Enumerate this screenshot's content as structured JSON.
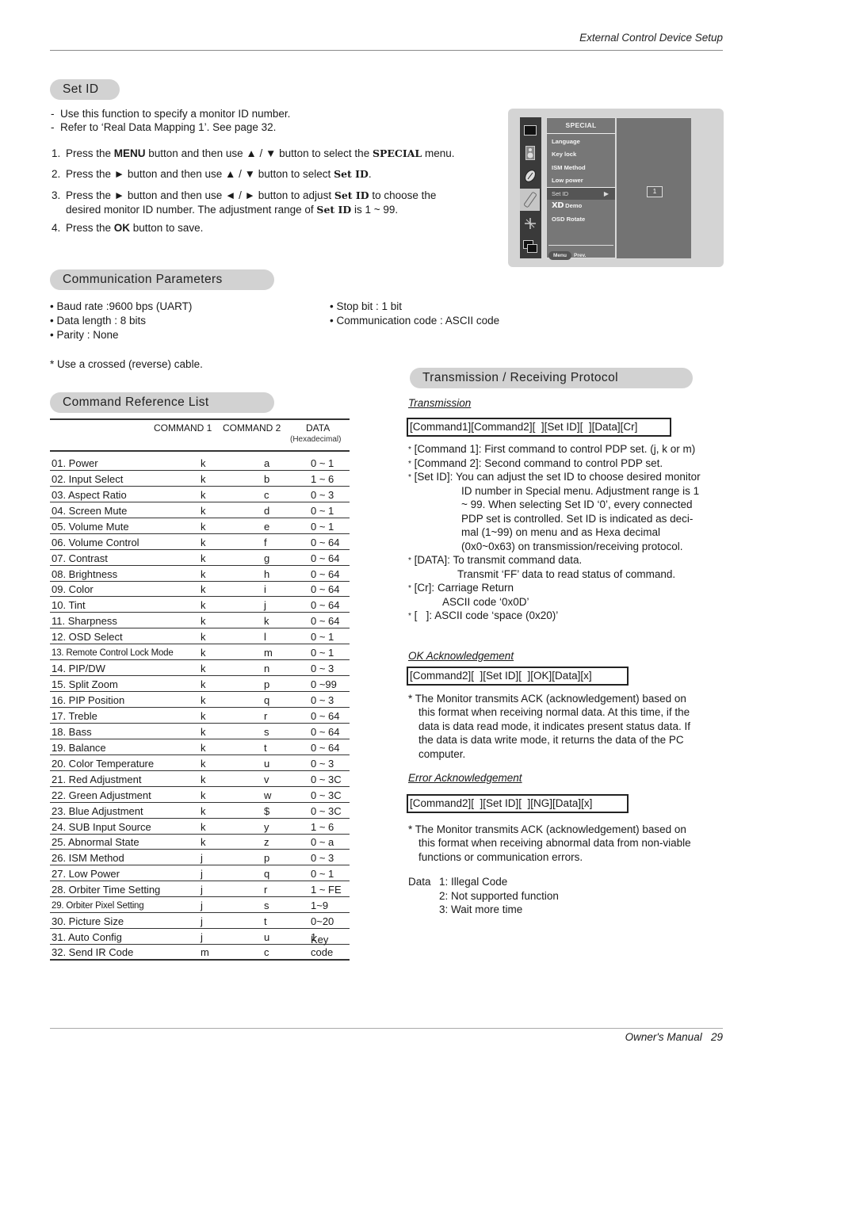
{
  "header": {
    "running_title": "External Control Device Setup"
  },
  "footer": {
    "label": "Owner's Manual",
    "page_number": "29"
  },
  "set_id": {
    "heading": "Set ID",
    "notes": [
      "Use this function to specify a monitor ID number.",
      "Refer to ‘Real Data Mapping 1’. See page 32."
    ],
    "steps": [
      {
        "num": "1.",
        "parts": [
          "Press the ",
          "MENU",
          " button and then use ",
          "▲ / ▼",
          " button to select the ",
          "SPECIAL",
          " menu."
        ]
      },
      {
        "num": "2.",
        "parts": [
          "Press the ",
          "►",
          " button and then use ",
          "▲ / ▼",
          " button to select ",
          "Set ID",
          "."
        ]
      },
      {
        "num": "3.",
        "line1": [
          "Press the ",
          "►",
          " button and then use ",
          "◄ / ►",
          " button to adjust  ",
          "Set ID",
          " to choose the"
        ],
        "line2": [
          "desired monitor ID number. The adjustment range of ",
          "Set ID",
          " is 1 ~ 99."
        ]
      },
      {
        "num": "4.",
        "parts": [
          "Press the ",
          "OK",
          " button to save."
        ]
      }
    ]
  },
  "osd": {
    "menu_title": "SPECIAL",
    "items": [
      "Language",
      "Key lock",
      "ISM Method",
      "Low power",
      "Set ID",
      "Demo",
      "OSD Rotate"
    ],
    "selected_item": "Set ID",
    "xd_logo": "XD",
    "footer_button": "Menu",
    "footer_label": "Prev.",
    "value": "1",
    "side_icons": [
      "picture-icon",
      "speaker-icon",
      "time-icon",
      "special-icon",
      "screen-icon",
      "pip-icon"
    ]
  },
  "comm_params": {
    "heading": "Communication Parameters",
    "left": [
      "Baud rate :9600 bps (UART)",
      "Data length : 8 bits",
      "Parity : None"
    ],
    "right": [
      "Stop bit : 1 bit",
      "Communication code : ASCII code"
    ],
    "note": "* Use a crossed (reverse) cable."
  },
  "command_list": {
    "heading": "Command Reference List",
    "columns": [
      "COMMAND 1",
      "COMMAND 2",
      "DATA"
    ],
    "data_subheader": "(Hexadecimal)",
    "rows": [
      {
        "name": "01. Power",
        "cmd1": "k",
        "cmd2": "a",
        "data": "0 ~ 1"
      },
      {
        "name": "02. Input Select",
        "cmd1": "k",
        "cmd2": "b",
        "data": "1 ~ 6"
      },
      {
        "name": "03. Aspect Ratio",
        "cmd1": "k",
        "cmd2": "c",
        "data": "0 ~ 3"
      },
      {
        "name": "04. Screen Mute",
        "cmd1": "k",
        "cmd2": "d",
        "data": "0 ~ 1"
      },
      {
        "name": "05. Volume Mute",
        "cmd1": "k",
        "cmd2": "e",
        "data": "0 ~ 1"
      },
      {
        "name": "06. Volume Control",
        "cmd1": "k",
        "cmd2": "f",
        "data": "0 ~ 64"
      },
      {
        "name": "07. Contrast",
        "cmd1": "k",
        "cmd2": "g",
        "data": "0 ~ 64"
      },
      {
        "name": "08. Brightness",
        "cmd1": "k",
        "cmd2": "h",
        "data": "0 ~ 64"
      },
      {
        "name": "09. Color",
        "cmd1": "k",
        "cmd2": "i",
        "data": "0 ~ 64"
      },
      {
        "name": "10. Tint",
        "cmd1": "k",
        "cmd2": "j",
        "data": "0 ~ 64"
      },
      {
        "name": "11. Sharpness",
        "cmd1": "k",
        "cmd2": "k",
        "data": "0 ~ 64"
      },
      {
        "name": "12. OSD Select",
        "cmd1": "k",
        "cmd2": "l",
        "data": "0 ~ 1"
      },
      {
        "name": "13. Remote Control Lock Mode",
        "cmd1": "k",
        "cmd2": "m",
        "data": "0 ~ 1"
      },
      {
        "name": "14. PIP/DW",
        "cmd1": "k",
        "cmd2": "n",
        "data": "0 ~ 3"
      },
      {
        "name": "15. Split Zoom",
        "cmd1": "k",
        "cmd2": "p",
        "data": "0 ~99"
      },
      {
        "name": "16. PIP Position",
        "cmd1": "k",
        "cmd2": "q",
        "data": "0 ~ 3"
      },
      {
        "name": "17. Treble",
        "cmd1": "k",
        "cmd2": "r",
        "data": "0 ~ 64"
      },
      {
        "name": "18. Bass",
        "cmd1": "k",
        "cmd2": "s",
        "data": "0 ~ 64"
      },
      {
        "name": "19. Balance",
        "cmd1": "k",
        "cmd2": "t",
        "data": "0 ~ 64"
      },
      {
        "name": "20. Color Temperature",
        "cmd1": "k",
        "cmd2": "u",
        "data": "0 ~ 3"
      },
      {
        "name": "21. Red Adjustment",
        "cmd1": "k",
        "cmd2": "v",
        "data": "0 ~ 3C"
      },
      {
        "name": "22. Green Adjustment",
        "cmd1": "k",
        "cmd2": "w",
        "data": "0 ~ 3C"
      },
      {
        "name": "23. Blue Adjustment",
        "cmd1": "k",
        "cmd2": "$",
        "data": "0 ~ 3C"
      },
      {
        "name": "24. SUB Input Source",
        "cmd1": "k",
        "cmd2": "y",
        "data": "1 ~ 6"
      },
      {
        "name": "25. Abnormal State",
        "cmd1": "k",
        "cmd2": "z",
        "data": "0 ~ a"
      },
      {
        "name": "26. ISM Method",
        "cmd1": "j",
        "cmd2": "p",
        "data": "0 ~ 3"
      },
      {
        "name": "27. Low Power",
        "cmd1": "j",
        "cmd2": "q",
        "data": "0 ~ 1"
      },
      {
        "name": "28. Orbiter Time Setting",
        "cmd1": "j",
        "cmd2": "r",
        "data": "1 ~ FE"
      },
      {
        "name": "29. Orbiter Pixel Setting",
        "cmd1": "j",
        "cmd2": "s",
        "data": "1~9"
      },
      {
        "name": "30. Picture Size",
        "cmd1": "j",
        "cmd2": "t",
        "data": "0~20"
      },
      {
        "name": "31. Auto Config",
        "cmd1": "j",
        "cmd2": "u",
        "data": "1"
      },
      {
        "name": "32. Send IR Code",
        "cmd1": "m",
        "cmd2": "c",
        "data": "Key code"
      }
    ]
  },
  "protocol": {
    "heading": "Transmission / Receiving  Protocol",
    "transmission": {
      "label": "Transmission",
      "format": "[Command1][Command2][  ][Set ID][  ][Data][Cr]",
      "notes": [
        {
          "key": "[Command 1]:",
          "text": "First command to control PDP set. (j, k or m)"
        },
        {
          "key": "[Command 2]:",
          "text": "Second command to control PDP set."
        },
        {
          "key": "[Set ID]:",
          "text": "You can adjust the set ID to choose desired monitor",
          "cont": [
            "ID number in Special menu. Adjustment range is 1",
            "~ 99. When selecting Set ID ‘0’, every connected",
            "PDP set is controlled. Set ID is indicated as deci-",
            "mal (1~99) on menu and as Hexa decimal",
            "(0x0~0x63) on transmission/receiving protocol."
          ]
        },
        {
          "key": "[DATA]:",
          "text": "To transmit command data.",
          "cont": [
            "Transmit ‘FF’ data to read status of command."
          ]
        },
        {
          "key": "[Cr]:",
          "text": "Carriage Return",
          "cont": [
            "ASCII code ‘0x0D’"
          ]
        },
        {
          "key": "[   ]:",
          "text": "ASCII code ‘space (0x20)’"
        }
      ]
    },
    "ok_ack": {
      "label": "OK Acknowledgement",
      "format": "[Command2][  ][Set ID][  ][OK][Data][x]",
      "note_lines": [
        "* The Monitor transmits ACK (acknowledgement) based on",
        "this format when receiving normal data. At this time, if the",
        "data is data read mode, it indicates present status data. If",
        "the data is data write mode, it returns the data of the PC",
        "computer."
      ]
    },
    "error_ack": {
      "label": "Error Acknowledgement",
      "format": "[Command2][  ][Set ID][  ][NG][Data][x]",
      "note_lines": [
        "* The Monitor transmits ACK (acknowledgement) based on",
        "this format when receiving abnormal data from non-viable",
        "functions or communication errors."
      ],
      "data_label": "Data",
      "data_codes": [
        "1: Illegal Code",
        "2: Not supported function",
        "3: Wait more time"
      ]
    }
  }
}
